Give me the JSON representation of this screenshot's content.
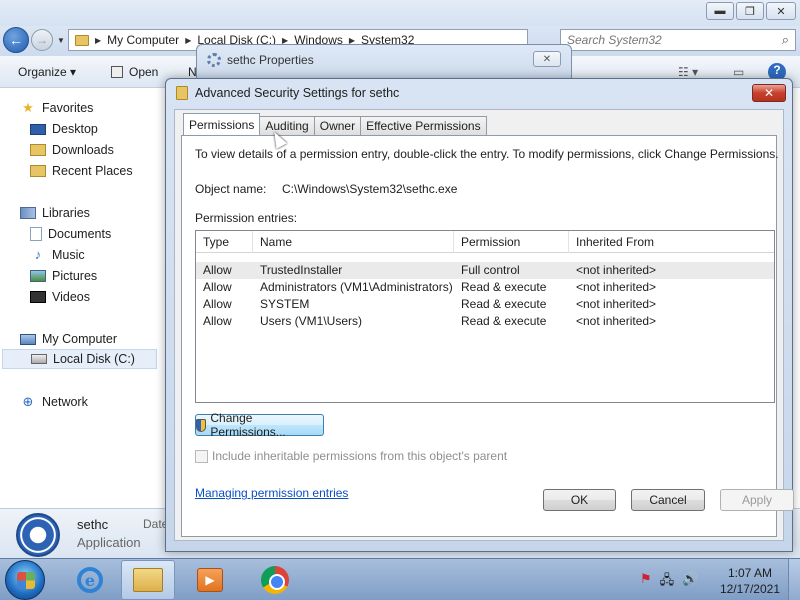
{
  "explorer": {
    "window_buttons": {
      "minimize": "▬",
      "maximize": "❐",
      "close": "✕"
    },
    "breadcrumb": [
      "My Computer",
      "Local Disk (C:)",
      "Windows",
      "System32"
    ],
    "search_placeholder": "Search System32",
    "toolbar": {
      "organize": "Organize ▾",
      "open": "Open",
      "truncated": "N"
    },
    "sidebar": {
      "favorites": "Favorites",
      "favorites_items": [
        "Desktop",
        "Downloads",
        "Recent Places"
      ],
      "libraries": "Libraries",
      "libraries_items": [
        "Documents",
        "Music",
        "Pictures",
        "Videos"
      ],
      "computer": "My Computer",
      "computer_items": [
        "Local Disk (C:)"
      ],
      "network": "Network"
    },
    "details": {
      "name": "sethc",
      "type": "Application",
      "date_label": "Date"
    }
  },
  "properties_dialog": {
    "title": "sethc Properties",
    "close": "✕"
  },
  "advanced_dialog": {
    "title": "Advanced Security Settings for sethc",
    "close": "✕",
    "tabs": [
      "Permissions",
      "Auditing",
      "Owner",
      "Effective Permissions"
    ],
    "active_tab": "Permissions",
    "info_text": "To view details of a permission entry, double-click the entry. To modify permissions, click Change Permissions.",
    "object_name_label": "Object name:",
    "object_name": "C:\\Windows\\System32\\sethc.exe",
    "entries_label": "Permission entries:",
    "columns": [
      "Type",
      "Name",
      "Permission",
      "Inherited From"
    ],
    "entries": [
      {
        "type": "Allow",
        "name": "TrustedInstaller",
        "permission": "Full control",
        "inherited": "<not inherited>"
      },
      {
        "type": "Allow",
        "name": "Administrators (VM1\\Administrators)",
        "permission": "Read & execute",
        "inherited": "<not inherited>"
      },
      {
        "type": "Allow",
        "name": "SYSTEM",
        "permission": "Read & execute",
        "inherited": "<not inherited>"
      },
      {
        "type": "Allow",
        "name": "Users (VM1\\Users)",
        "permission": "Read & execute",
        "inherited": "<not inherited>"
      }
    ],
    "change_permissions": "Change Permissions...",
    "include_inheritable": "Include inheritable permissions from this object's parent",
    "managing_link": "Managing permission entries",
    "ok": "OK",
    "cancel": "Cancel",
    "apply": "Apply"
  },
  "taskbar": {
    "time": "1:07 AM",
    "date": "12/17/2021",
    "ie_glyph": "e",
    "wmp_glyph": "▶"
  }
}
